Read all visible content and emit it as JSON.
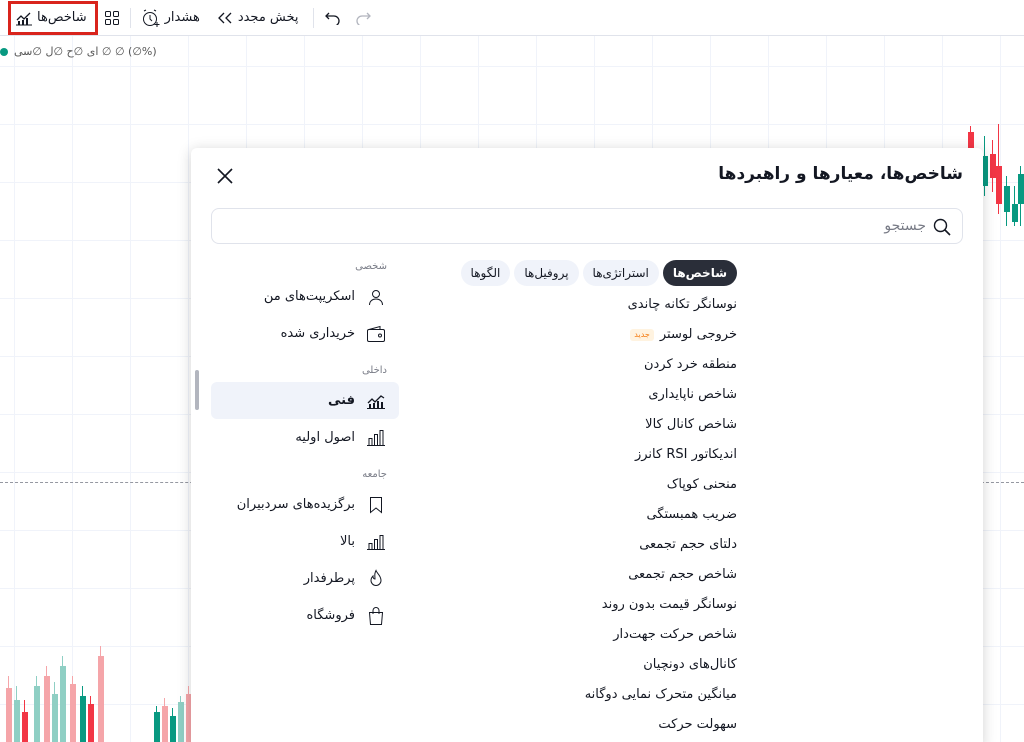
{
  "toolbar": {
    "indicators_label": "شاخص‌ها",
    "alert_label": "هشدار",
    "replay_label": "پخش مجدد"
  },
  "legend": {
    "text": "ای ∅ح ∅ل ∅سی ∅ ∅ (∅%)"
  },
  "modal": {
    "title": "شاخص‌ها، معیارها و راهبردها",
    "search_placeholder": "جستجو",
    "nav": {
      "personal_heading": "شخصی",
      "my_scripts": "اسکریپت‌های من",
      "purchased": "خریداری شده",
      "builtin_heading": "داخلی",
      "technical": "فنی",
      "fundamentals": "اصول اولیه",
      "community_heading": "جامعه",
      "editors_picks": "برگزیده‌های سردبیران",
      "top": "بالا",
      "trending": "پرطرفدار",
      "store": "فروشگاه"
    },
    "tabs": [
      "شاخص‌ها",
      "استراتژی‌ها",
      "پروفیل‌ها",
      "الگوها"
    ],
    "new_badge": "جدید",
    "items": [
      "نوسانگر تکانه چاندی",
      "خروجی لوستر",
      "منطقه خرد کردن",
      "شاخص ناپایداری",
      "شاخص کانال کالا",
      "اندیکاتور RSI کانرز",
      "منحنی کوپاک",
      "ضریب همبستگی",
      "دلتای حجم تجمعی",
      "شاخص حجم تجمعی",
      "نوسانگر قیمت بدون روند",
      "شاخص حرکت جهت‌دار",
      "کانال‌های دونچیان",
      "میانگین متحرک نمایی دوگانه",
      "سهولت حرکت"
    ]
  },
  "colors": {
    "up": "#089981",
    "down": "#f23645",
    "up_light": "#8fcfc4",
    "down_light": "#f5a5a9",
    "highlight": "#d9241c"
  }
}
